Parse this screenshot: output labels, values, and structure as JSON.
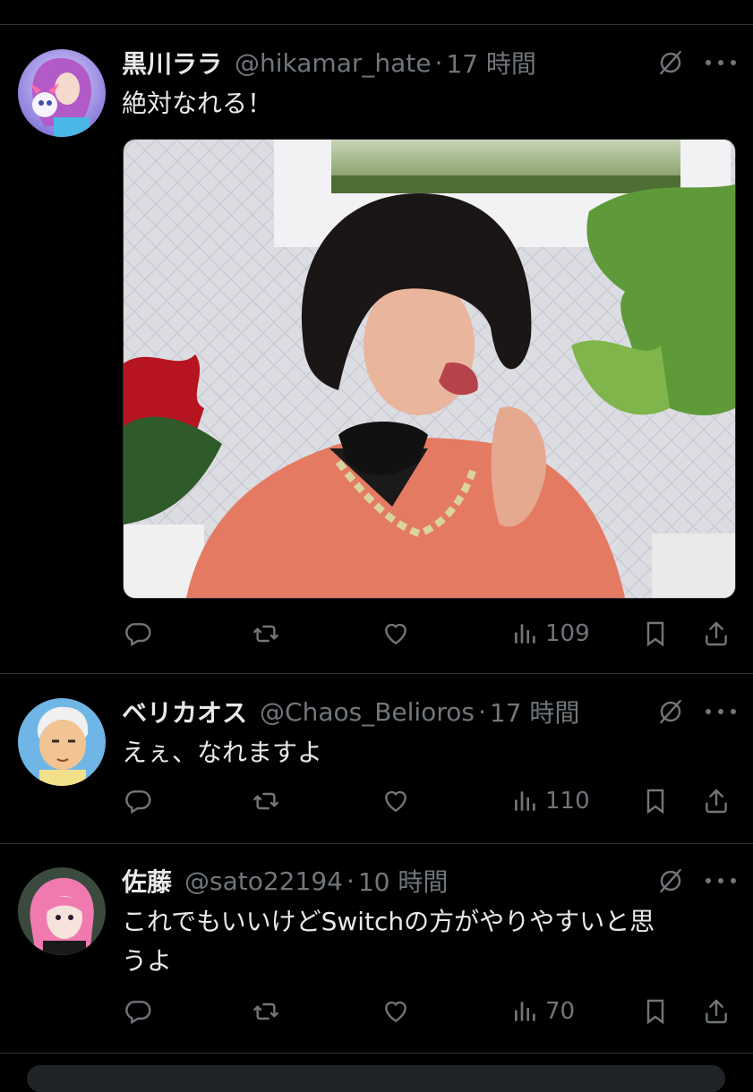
{
  "posts": [
    {
      "name": "黒川ララ",
      "handle": "@hikamar_hate",
      "separator": "·",
      "time": "17 時間",
      "text_lines": [
        "絶対なれる！"
      ],
      "views": "109"
    },
    {
      "name": "ベリカオス",
      "handle": "@Chaos_Belioros",
      "separator": "·",
      "time": "17 時間",
      "text_lines": [
        "えぇ、なれますよ"
      ],
      "views": "110"
    },
    {
      "name": "佐藤",
      "handle": "@sato22194",
      "separator": "·",
      "time": "10 時間",
      "text_lines": [
        "これでもいいけどSwitchの方がやりやすいと思",
        "うよ"
      ],
      "views": "70"
    }
  ],
  "icons": {
    "reply": "reply-icon",
    "repost": "repost-icon",
    "like": "like-icon",
    "views": "views-icon",
    "bookmark": "bookmark-icon",
    "share": "share-icon",
    "grok": "grok-icon",
    "more": "more-icon"
  },
  "colors": {
    "background": "#000000",
    "text": "#e7e9ea",
    "muted": "#71767b",
    "divider": "#2f3336"
  }
}
